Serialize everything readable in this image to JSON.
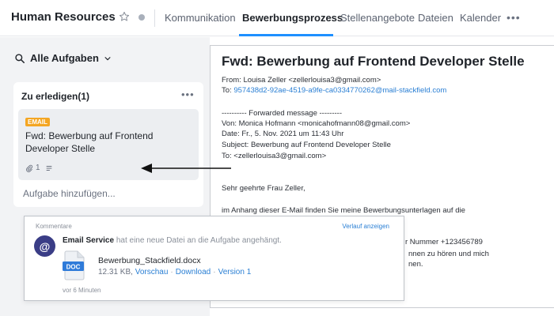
{
  "header": {
    "title": "Human Resources",
    "tabs": [
      "Kommunikation",
      "Bewerbungsprozess",
      "Stellenangebote",
      "Dateien",
      "Kalender"
    ],
    "active_tab": "Bewerbungsprozess",
    "more": "•••"
  },
  "filter": {
    "label": "Alle Aufgaben"
  },
  "column": {
    "title": "Zu erledigen(1)",
    "more": "•••",
    "add_task": "Aufgabe hinzufügen...",
    "card": {
      "badge": "EMAIL",
      "title": "Fwd: Bewerbung auf Frontend Developer Stelle",
      "attachments": "1"
    }
  },
  "email": {
    "subject": "Fwd: Bewerbung auf Frontend Developer Stelle",
    "from": "From: Louisa Zeller <zellerlouisa3@gmail.com>",
    "to_label": "To: ",
    "to_address": "957438d2-92ae-4519-a9fe-ca0334770262@mail-stackfield.com",
    "forward_header": "---------- Forwarded message ---------",
    "fwd_from": "Von: Monica Hofmann <monicahofmann08@gmail.com>",
    "fwd_date": "Date: Fr., 5. Nov. 2021 um 11:43 Uhr",
    "fwd_subject": "Subject: Bewerbung auf Frontend Developer Stelle",
    "fwd_to": "To: <zellerlouisa3@gmail.com>",
    "greeting": "Sehr geehrte Frau Zeller,",
    "body_1": "im Anhang dieser E-Mail finden Sie meine Bewerbungsunterlagen auf die",
    "body_2": "r Nummer +123456789",
    "body_3": "nnen zu hören und mich",
    "body_4": "nen."
  },
  "comment": {
    "heading": "Kommentare",
    "history_link": "Verlauf anzeigen",
    "avatar": "@",
    "actor": "Email Service",
    "action": " hat eine neue Datei an die Aufgabe angehängt.",
    "file_icon_text": "DOC",
    "file_name": "Bewerbung_Stackfield.docx",
    "file_size": "12.31 KB, ",
    "preview": "Vorschau",
    "download": "Download",
    "version": "Version 1",
    "time": "vor 6 Minuten"
  },
  "colors": {
    "accent": "#1e8fff",
    "badge": "#f4a623",
    "avatar": "#3a3d86",
    "doc_icon": "#2f7bd9",
    "link": "#2a7fd4"
  }
}
